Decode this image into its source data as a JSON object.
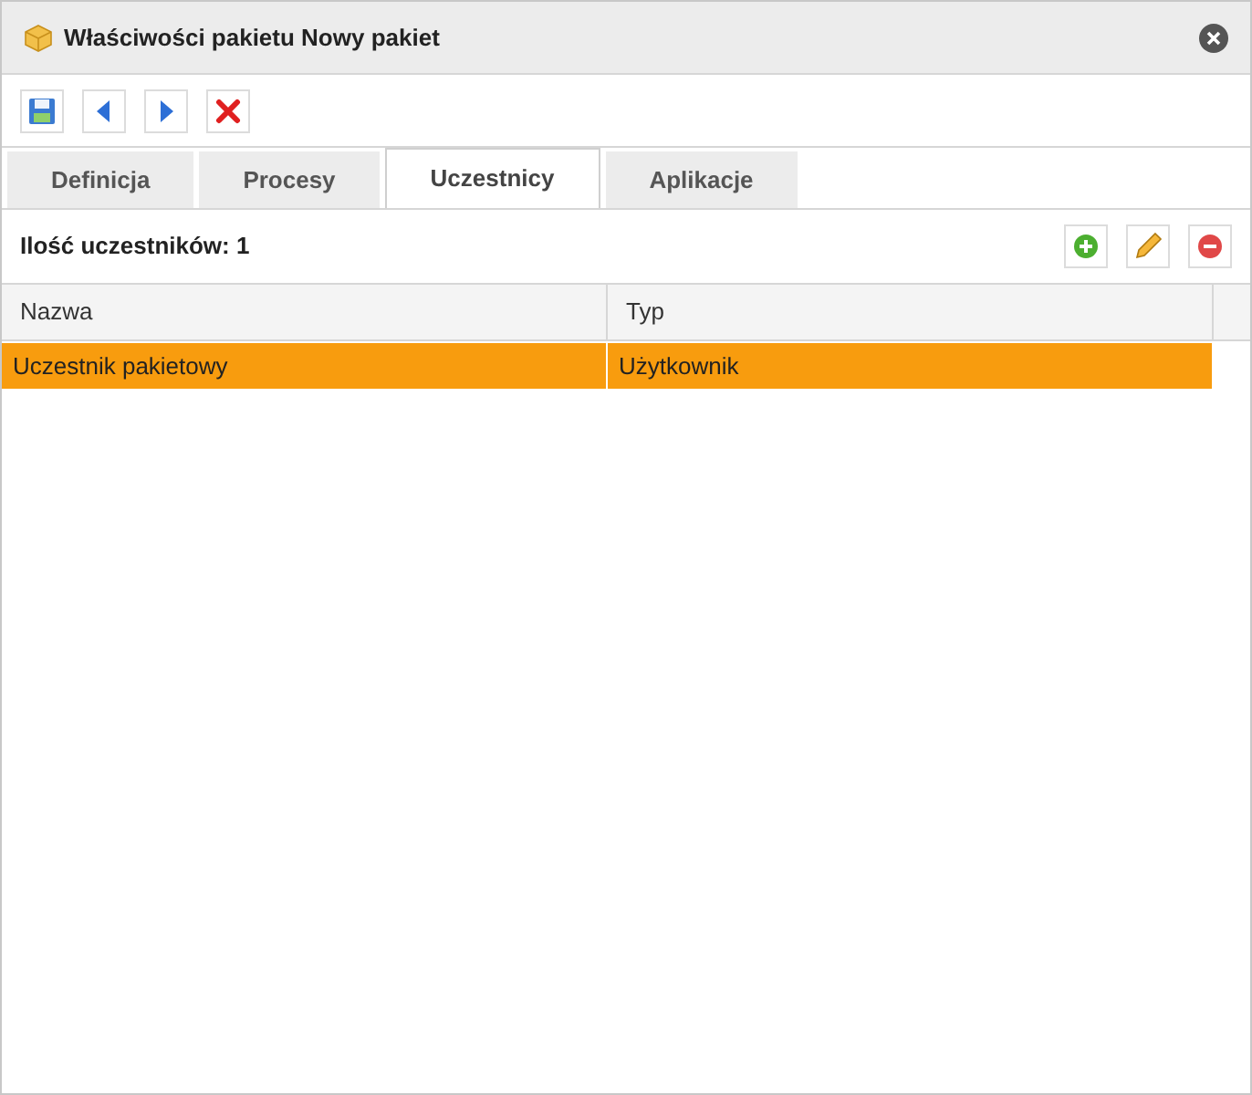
{
  "window": {
    "title": "Właściwości pakietu Nowy pakiet"
  },
  "tabs": [
    {
      "label": "Definicja",
      "selected": false
    },
    {
      "label": "Procesy",
      "selected": false
    },
    {
      "label": "Uczestnicy",
      "selected": true
    },
    {
      "label": "Aplikacje",
      "selected": false
    }
  ],
  "count_label": "Ilość uczestników: 1",
  "table": {
    "columns": [
      "Nazwa",
      "Typ"
    ],
    "rows": [
      {
        "cells": [
          "Uczestnik pakietowy",
          "Użytkownik"
        ],
        "selected": true
      }
    ]
  }
}
